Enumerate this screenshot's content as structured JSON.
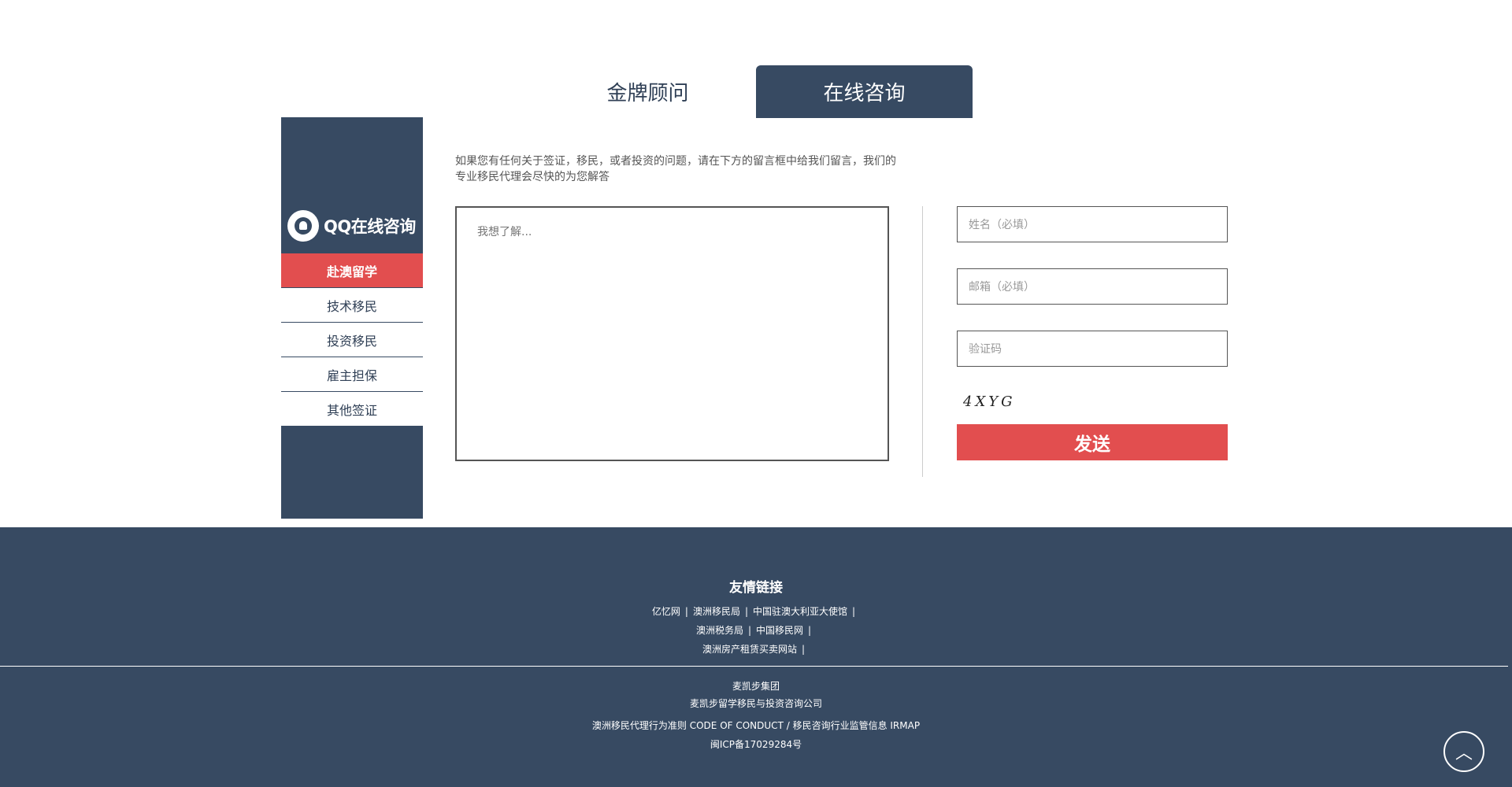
{
  "tabs": {
    "gold": "金牌顾问",
    "online": "在线咨询"
  },
  "sidebar": {
    "logo_text": "QQ在线咨询",
    "items": [
      {
        "label": "赴澳留学",
        "active": true
      },
      {
        "label": "技术移民"
      },
      {
        "label": "投资移民"
      },
      {
        "label": "雇主担保"
      },
      {
        "label": "其他签证"
      }
    ]
  },
  "form": {
    "intro_line1": "如果您有任何关于签证，移民，或者投资的问题，请在下方的留言框中给我们留言，我们的",
    "intro_line2": "专业移民代理会尽快的为您解答",
    "message_placeholder": "我想了解...",
    "name_placeholder": "姓名（必填）",
    "email_placeholder": "邮箱（必填）",
    "captcha_placeholder": "验证码",
    "captcha_text": "4XYG",
    "send_label": "发送"
  },
  "footer": {
    "friend_links_title": "友情链接",
    "link_rows": [
      [
        "亿忆网",
        "澳洲移民局",
        "中国驻澳大利亚大使馆"
      ],
      [
        "澳洲税务局",
        "中国移民网"
      ],
      [
        "澳洲房产租赁买卖网站"
      ]
    ],
    "company_group": "麦凯步集团",
    "company_name": "麦凯步留学移民与投资咨询公司",
    "conduct_text": "澳洲移民代理行为准则 CODE OF CONDUCT / 移民咨询行业监管信息 IRMAP",
    "icp": "闽ICP备17029284号",
    "back_to_top_icon": "chevron-up-icon"
  }
}
